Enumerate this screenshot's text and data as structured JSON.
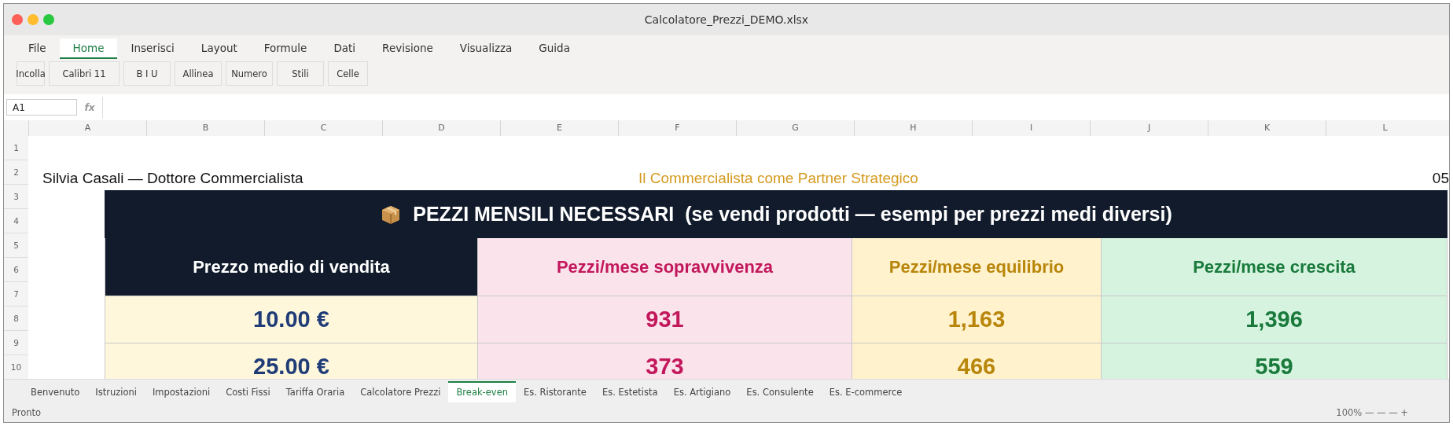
{
  "window": {
    "title": "Calcolatore_Prezzi_DEMO.xlsx"
  },
  "ribbon_tabs": [
    {
      "label": "File",
      "selected": false
    },
    {
      "label": "Home",
      "selected": true
    },
    {
      "label": "Inserisci",
      "selected": false
    },
    {
      "label": "Layout",
      "selected": false
    },
    {
      "label": "Formule",
      "selected": false
    },
    {
      "label": "Dati",
      "selected": false
    },
    {
      "label": "Revisione",
      "selected": false
    },
    {
      "label": "Visualizza",
      "selected": false
    },
    {
      "label": "Guida",
      "selected": false
    }
  ],
  "ribbon_buttons": [
    "Incolla",
    "Calibri 11",
    "B I U",
    "Allinea",
    "Numero",
    "Stili",
    "Celle"
  ],
  "formula_bar": {
    "cell_ref": "A1",
    "fx_label": "fx"
  },
  "column_headers": [
    "A",
    "B",
    "C",
    "D",
    "E",
    "F",
    "G",
    "H",
    "I",
    "J",
    "K",
    "L"
  ],
  "row_headers": [
    "1",
    "2",
    "3",
    "4",
    "5",
    "6",
    "7",
    "8",
    "9",
    "10"
  ],
  "sheet_header": {
    "author": "Silvia Casali — Dottore Commercialista",
    "tagline": "Il Commercialista come Partner Strategico",
    "right_text": "05"
  },
  "overlay_table": {
    "title": "PEZZI MENSILI NECESSARI  (se vendi prodotti — esempi per prezzi medi diversi)",
    "columns": [
      {
        "label": "Prezzo medio di vendita",
        "kind": "price"
      },
      {
        "label": "Pezzi/mese sopravvivenza",
        "kind": "survival"
      },
      {
        "label": "Pezzi/mese equilibrio",
        "kind": "balance"
      },
      {
        "label": "Pezzi/mese crescita",
        "kind": "growth"
      }
    ],
    "rows": [
      [
        "10.00 €",
        "931",
        "1,163",
        "1,396"
      ],
      [
        "25.00 €",
        "373",
        "466",
        "559"
      ]
    ]
  },
  "sheet_tabs": [
    {
      "label": "Benvenuto",
      "selected": false
    },
    {
      "label": "Istruzioni",
      "selected": false
    },
    {
      "label": "Impostazioni",
      "selected": false
    },
    {
      "label": "Costi Fissi",
      "selected": false
    },
    {
      "label": "Tariffa Oraria",
      "selected": false
    },
    {
      "label": "Calcolatore Prezzi",
      "selected": false
    },
    {
      "label": "Break-even",
      "selected": true
    },
    {
      "label": "Es. Ristorante",
      "selected": false
    },
    {
      "label": "Es. Estetista",
      "selected": false
    },
    {
      "label": "Es. Artigiano",
      "selected": false
    },
    {
      "label": "Es. Consulente",
      "selected": false
    },
    {
      "label": "Es. E-commerce",
      "selected": false
    }
  ],
  "status_bar": {
    "text": "Pronto",
    "zoom": "100% — — — +"
  }
}
